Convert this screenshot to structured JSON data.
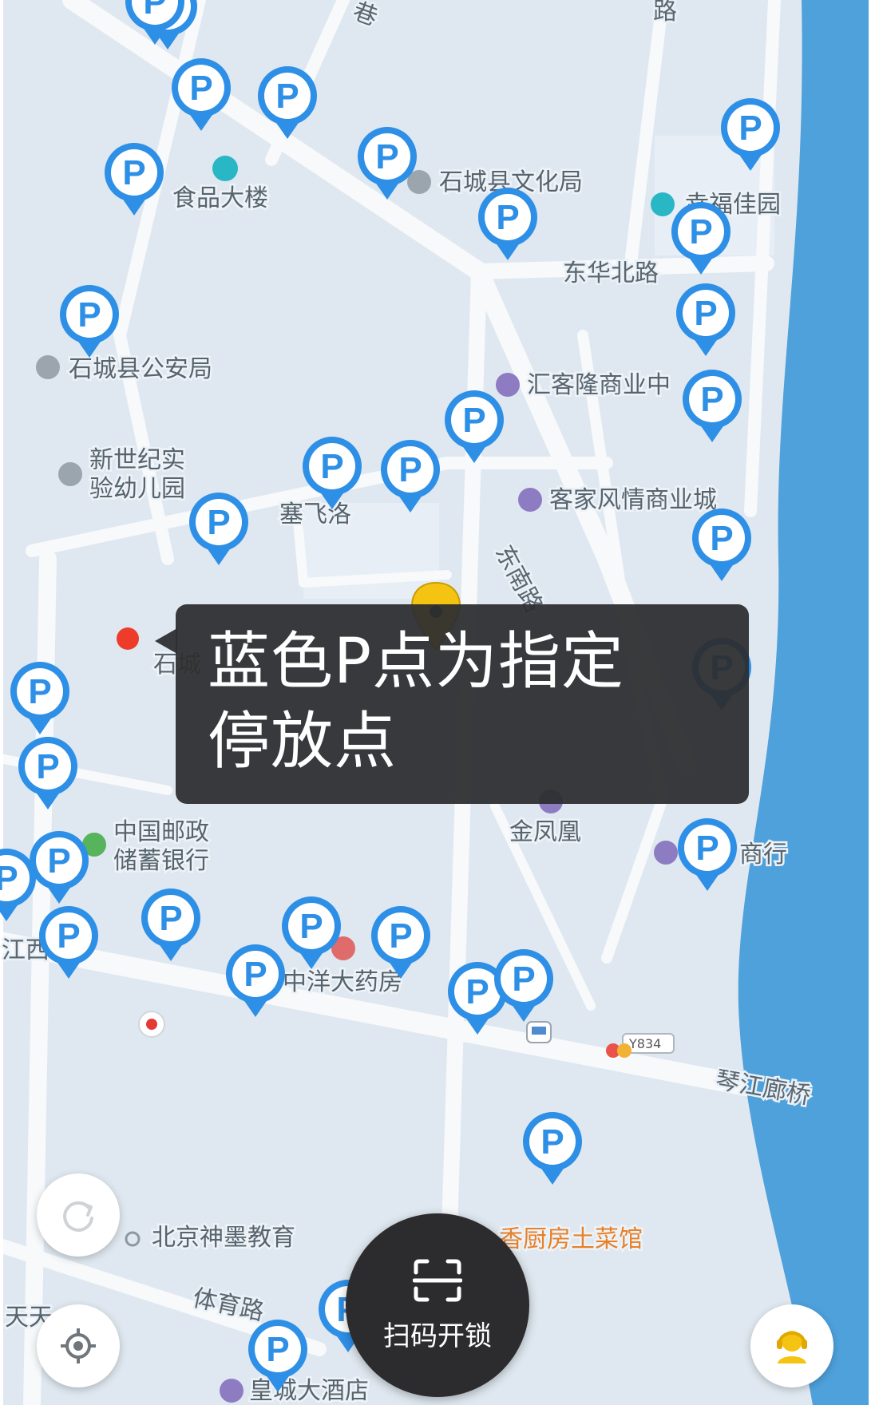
{
  "colors": {
    "map_bg": "#dfe8f0",
    "road": "#f7f9fb",
    "river": "#4fa1dc",
    "parking_pin": "#2e8fe6",
    "tooltip_bg": "#2d2e30",
    "scan_button": "#2c2c2e",
    "location_pin": "#f5c312",
    "red_dot": "#ee3c2a"
  },
  "map": {
    "pois": [
      "食品大楼",
      "石城县文化局",
      "幸福佳园",
      "东华北路",
      "石城县公安局",
      "汇客隆商业中",
      "新世纪实",
      "验幼儿园",
      "塞飞洛",
      "客家风情商业城",
      "东南路",
      "石城",
      "金凤凰",
      "中国邮政",
      "储蓄银行",
      "商行",
      "中洋大药房",
      "琴江廊桥",
      "北京神墨教育",
      "香厨房土菜馆",
      "体育路",
      "皇城大酒店",
      "天天",
      "江西",
      "Y834",
      "巷",
      "路"
    ],
    "parking_symbol": "P",
    "parking_pin_count": 33
  },
  "tooltip": {
    "line1": "蓝色P点为指定",
    "line2": "停放点"
  },
  "controls": {
    "refresh_icon": "refresh-icon",
    "locate_icon": "locate-icon",
    "service_icon": "customer-service-icon",
    "scan_icon": "scan-icon",
    "scan_label": "扫码开锁"
  }
}
